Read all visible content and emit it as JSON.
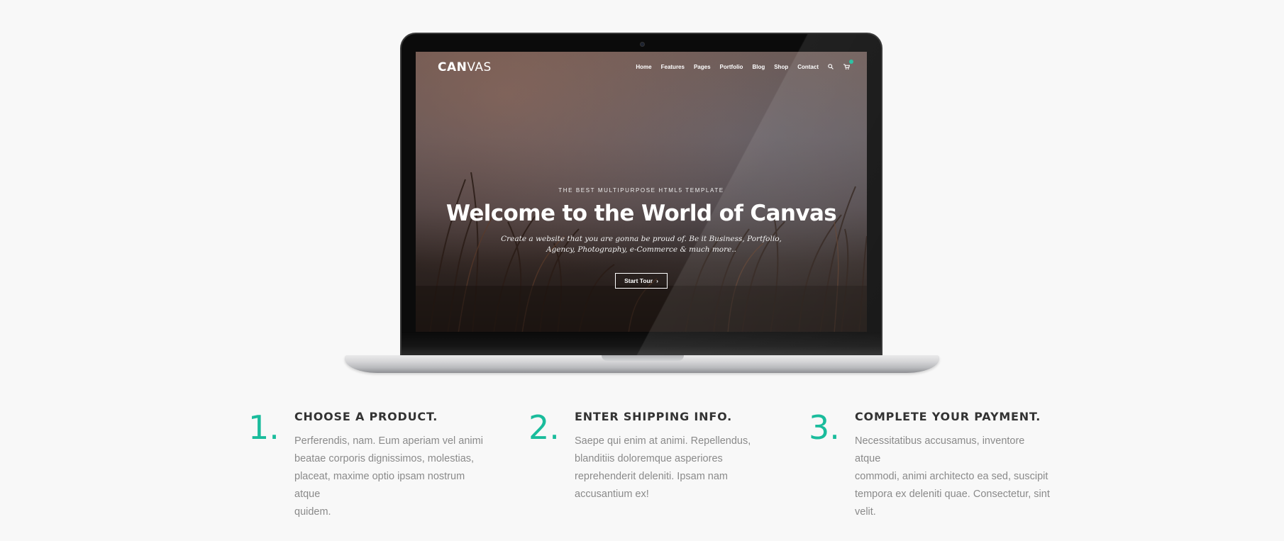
{
  "site": {
    "logo_bold": "CAN",
    "logo_light": "VAS",
    "nav": [
      "Home",
      "Features",
      "Pages",
      "Portfolio",
      "Blog",
      "Shop",
      "Contact"
    ],
    "icons": [
      "search-icon",
      "cart-icon"
    ],
    "accent": "#1abc9c"
  },
  "hero": {
    "kicker": "THE BEST MULTIPURPOSE HTML5 TEMPLATE",
    "title": "Welcome to the World of Canvas",
    "desc_line1": "Create a website that you are gonna be proud of. Be it Business, Portfolio,",
    "desc_line2": "Agency, Photography, e-Commerce & much more..",
    "button": "Start Tour",
    "button_icon": "chevron-right-icon"
  },
  "steps": [
    {
      "number": "1.",
      "title": "CHOOSE A PRODUCT.",
      "lines": [
        "Perferendis, nam. Eum aperiam vel animi",
        "beatae corporis dignissimos, molestias,",
        "placeat, maxime optio ipsam nostrum atque",
        "quidem."
      ]
    },
    {
      "number": "2.",
      "title": "ENTER SHIPPING INFO.",
      "lines": [
        "Saepe qui enim at animi. Repellendus,",
        "blanditiis doloremque asperiores",
        "reprehenderit deleniti. Ipsam nam",
        "accusantium ex!"
      ]
    },
    {
      "number": "3.",
      "title": "COMPLETE YOUR PAYMENT.",
      "lines": [
        "Necessitatibus accusamus, inventore atque",
        "commodi, animi architecto ea sed, suscipit",
        "tempora ex deleniti quae. Consectetur, sint",
        "velit."
      ]
    }
  ]
}
